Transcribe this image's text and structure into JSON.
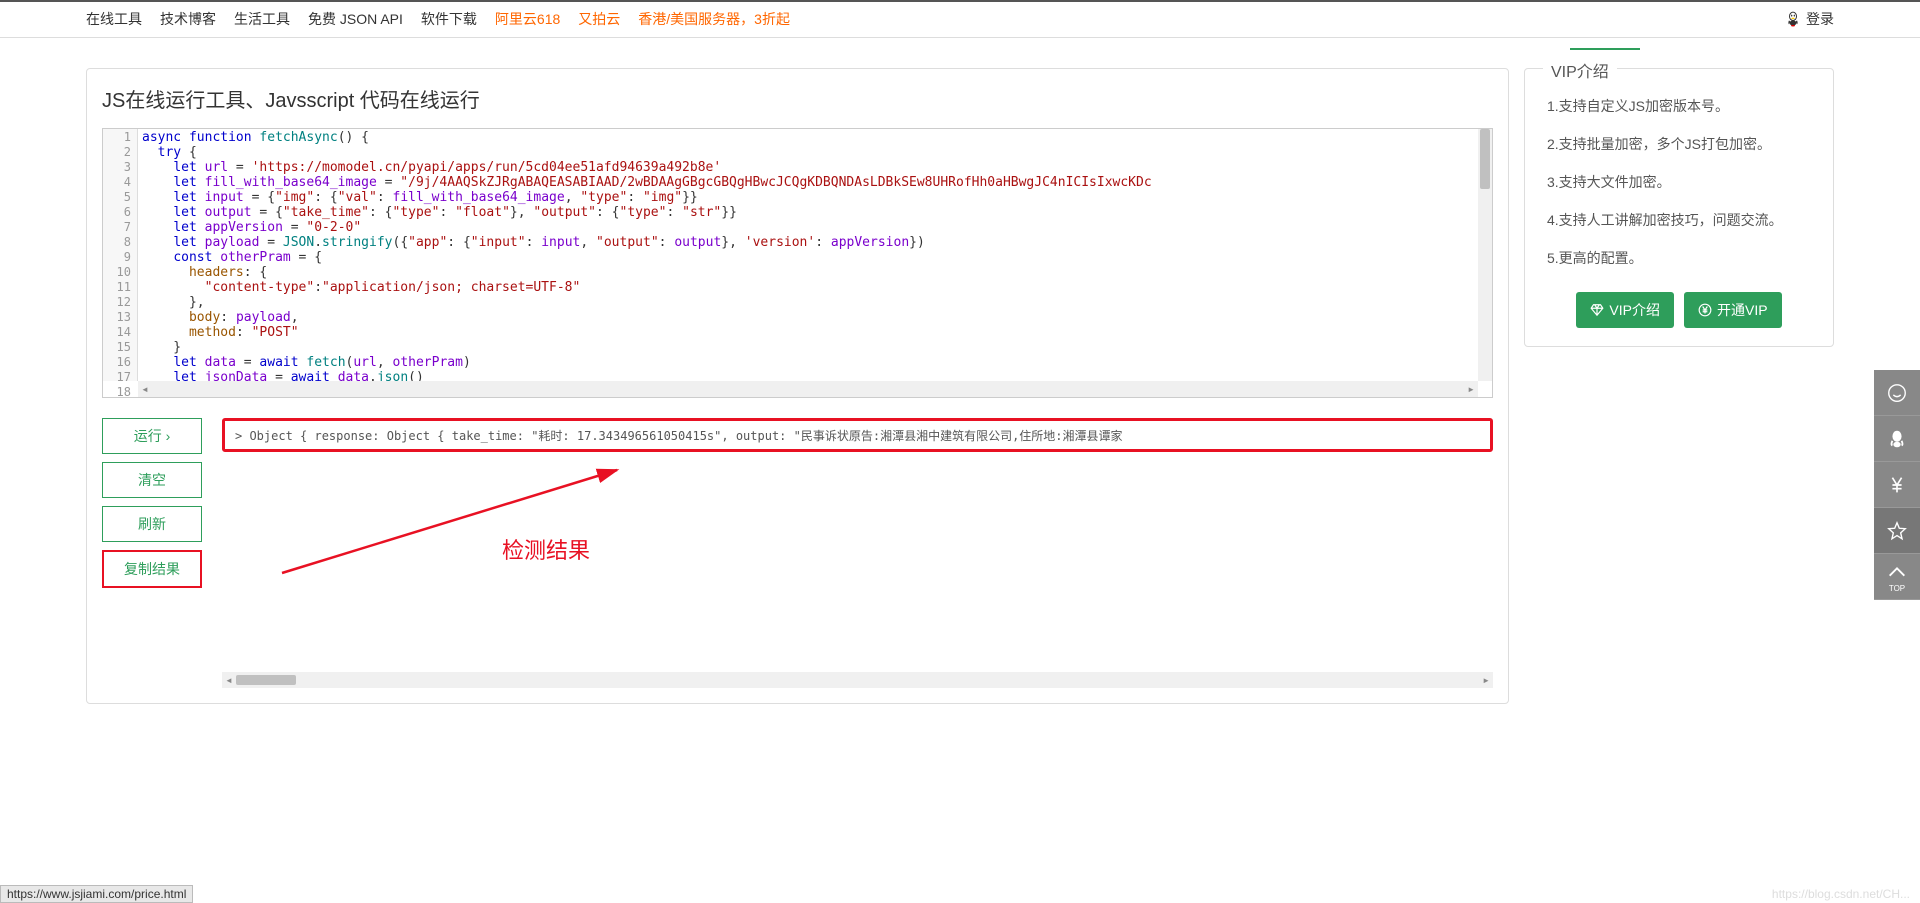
{
  "nav": {
    "items": [
      "在线工具",
      "技术博客",
      "生活工具",
      "免费 JSON API",
      "软件下载"
    ],
    "orange_items": [
      "阿里云618",
      "又拍云",
      "香港/美国服务器，3折起"
    ],
    "login": "登录"
  },
  "page": {
    "title": "JS在线运行工具、Javsscript 代码在线运行"
  },
  "code": {
    "lines": [
      {
        "n": "1",
        "html": "<span class='kw-blue'>async</span> <span class='kw-blue'>function</span> <span class='kw-teal'>fetchAsync</span>() {"
      },
      {
        "n": "2",
        "html": "  <span class='kw-blue'>try</span> {"
      },
      {
        "n": "3",
        "html": "    <span class='kw-blue'>let</span> <span class='var-purple'>url</span> = <span class='str-red'>'https://momodel.cn/pyapi/apps/run/5cd04ee51afd94639a492b8e'</span>"
      },
      {
        "n": "4",
        "html": "    <span class='kw-blue'>let</span> <span class='var-purple'>fill_with_base64_image</span> = <span class='str-red'>\"/9j/4AAQSkZJRgABAQEASABIAAD/2wBDAAgGBgcGBQgHBwcJCQgKDBQNDAsLDBkSEw8UHRofHh0aHBwgJC4nICIsIxwcKDc</span>"
      },
      {
        "n": "5",
        "html": "    <span class='kw-blue'>let</span> <span class='var-purple'>input</span> = {<span class='str-red'>\"img\"</span>: {<span class='str-red'>\"val\"</span>: <span class='var-purple'>fill_with_base64_image</span>, <span class='str-red'>\"type\"</span>: <span class='str-red'>\"img\"</span>}}"
      },
      {
        "n": "6",
        "html": "    <span class='kw-blue'>let</span> <span class='var-purple'>output</span> = {<span class='str-red'>\"take_time\"</span>: {<span class='str-red'>\"type\"</span>: <span class='str-red'>\"float\"</span>}, <span class='str-red'>\"output\"</span>: {<span class='str-red'>\"type\"</span>: <span class='str-red'>\"str\"</span>}}"
      },
      {
        "n": "7",
        "html": "    <span class='kw-blue'>let</span> <span class='var-purple'>appVersion</span> = <span class='str-red'>\"0-2-0\"</span>"
      },
      {
        "n": "8",
        "html": "    <span class='kw-blue'>let</span> <span class='var-purple'>payload</span> = <span class='kw-teal'>JSON</span>.<span class='kw-teal'>stringify</span>({<span class='str-red'>\"app\"</span>: {<span class='str-red'>\"input\"</span>: <span class='var-purple'>input</span>, <span class='str-red'>\"output\"</span>: <span class='var-purple'>output</span>}, <span class='str-red'>'version'</span>: <span class='var-purple'>appVersion</span>})"
      },
      {
        "n": "9",
        "html": "    <span class='kw-blue'>const</span> <span class='var-purple'>otherPram</span> = {"
      },
      {
        "n": "10",
        "html": "      <span class='prop-brown'>headers</span>: {"
      },
      {
        "n": "11",
        "html": "        <span class='str-red'>\"content-type\"</span>:<span class='str-red'>\"application/json; charset=UTF-8\"</span>"
      },
      {
        "n": "12",
        "html": "      },"
      },
      {
        "n": "13",
        "html": "      <span class='prop-brown'>body</span>: <span class='var-purple'>payload</span>,"
      },
      {
        "n": "14",
        "html": "      <span class='prop-brown'>method</span>: <span class='str-red'>\"POST\"</span>"
      },
      {
        "n": "15",
        "html": "    }"
      },
      {
        "n": "16",
        "html": "    <span class='kw-blue'>let</span> <span class='var-purple'>data</span> = <span class='kw-blue'>await</span> <span class='kw-teal'>fetch</span>(<span class='var-purple'>url</span>, <span class='var-purple'>otherPram</span>)"
      },
      {
        "n": "17",
        "html": "    <span class='kw-blue'>let</span> <span class='var-purple'>jsonData</span> = <span class='kw-blue'>await</span> <span class='var-purple'>data</span>.<span class='kw-teal'>json</span>()"
      },
      {
        "n": "18",
        "html": ""
      }
    ]
  },
  "buttons": {
    "run": "运行 ›",
    "clear": "清空",
    "refresh": "刷新",
    "copy": "复制结果"
  },
  "output": {
    "text": "> Object { response: Object { take_time: \"耗时: 17.343496561050415s\", output: \"民事诉状原告:湘潭县湘中建筑有限公司,住所地:湘潭县谭家",
    "label": "检测结果"
  },
  "vip": {
    "title": "VIP介绍",
    "items": [
      "1.支持自定义JS加密版本号。",
      "2.支持批量加密，多个JS打包加密。",
      "3.支持大文件加密。",
      "4.支持人工讲解加密技巧，问题交流。",
      "5.更高的配置。"
    ],
    "btn_intro": "VIP介绍",
    "btn_open": "开通VIP"
  },
  "status_url": "https://www.jsjiami.com/price.html",
  "watermark": "https://blog.csdn.net/CH...",
  "float_top": "TOP"
}
